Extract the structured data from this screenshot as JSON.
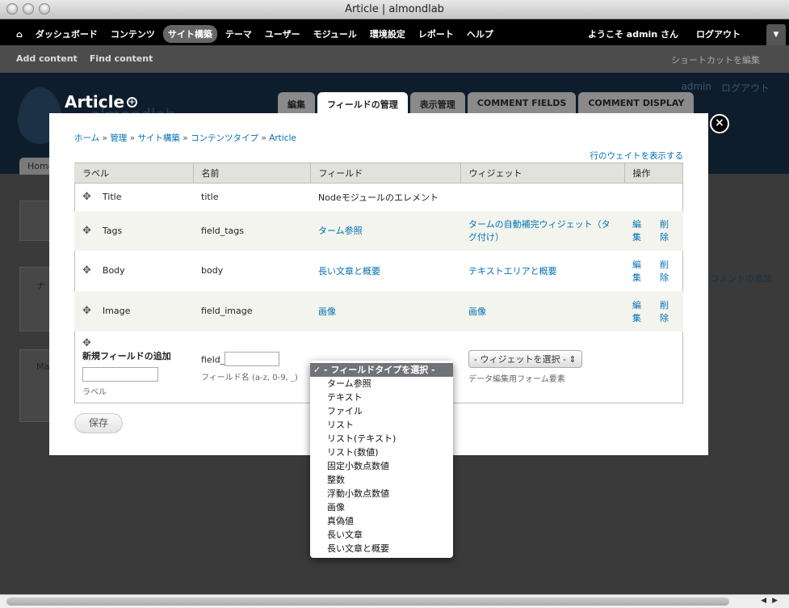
{
  "window": {
    "title": "Article | almondlab"
  },
  "toolbar": {
    "home_icon": "home-icon",
    "items": [
      "ダッシュボード",
      "コンテンツ",
      "サイト構築",
      "テーマ",
      "ユーザー",
      "モジュール",
      "環境設定",
      "レポート",
      "ヘルプ"
    ],
    "active": "サイト構築",
    "welcome": "ようこそ admin さん",
    "logout": "ログアウト"
  },
  "shortcuts": {
    "items": [
      "Add content",
      "Find content"
    ],
    "edit": "ショートカットを編集"
  },
  "header": {
    "title": "Article",
    "site_name": "almondlab",
    "user": "admin",
    "logout": "ログアウト",
    "tabs": [
      "編集",
      "フィールドの管理",
      "表示管理",
      "COMMENT FIELDS",
      "COMMENT DISPLAY"
    ],
    "active_tab": "フィールドの管理",
    "home_tab": "Home"
  },
  "background": {
    "comment_add": "コメントの追加",
    "box1": "ナ",
    "box2": "Ma"
  },
  "modal": {
    "breadcrumb": [
      "ホーム",
      "管理",
      "サイト構築",
      "コンテンツタイプ",
      "Article"
    ],
    "breadcrumb_sep": "»",
    "show_weights": "行のウェイトを表示する",
    "columns": [
      "ラベル",
      "名前",
      "フィールド",
      "ウィジェット",
      "操作"
    ],
    "rows": [
      {
        "label": "Title",
        "name": "title",
        "field": "Nodeモジュールのエレメント",
        "field_link": false,
        "widget": "",
        "edit": "",
        "delete": ""
      },
      {
        "label": "Tags",
        "name": "field_tags",
        "field": "ターム参照",
        "field_link": true,
        "widget": "タームの自動補完ウィジェット（タグ付け）",
        "edit": "編集",
        "delete": "削除"
      },
      {
        "label": "Body",
        "name": "body",
        "field": "長い文章と概要",
        "field_link": true,
        "widget": "テキストエリアと概要",
        "edit": "編集",
        "delete": "削除"
      },
      {
        "label": "Image",
        "name": "field_image",
        "field": "画像",
        "field_link": true,
        "widget": "画像",
        "edit": "編集",
        "delete": "削除"
      }
    ],
    "add": {
      "title": "新規フィールドの追加",
      "label_value": "",
      "label_hint": "ラベル",
      "name_prefix": "field_",
      "name_value": "",
      "name_hint": "フィールド名 (a-z, 0-9, _)",
      "widget_select": "- ウィジェットを選択 -",
      "widget_hint": "データ編集用フォーム要素"
    },
    "save": "保存"
  },
  "dropdown": {
    "selected": "- フィールドタイプを選択 -",
    "options": [
      "ターム参照",
      "テキスト",
      "ファイル",
      "リスト",
      "リスト(テキスト)",
      "リスト(数値)",
      "固定小数点数値",
      "整数",
      "浮動小数点数値",
      "画像",
      "真偽値",
      "長い文章",
      "長い文章と概要"
    ]
  }
}
